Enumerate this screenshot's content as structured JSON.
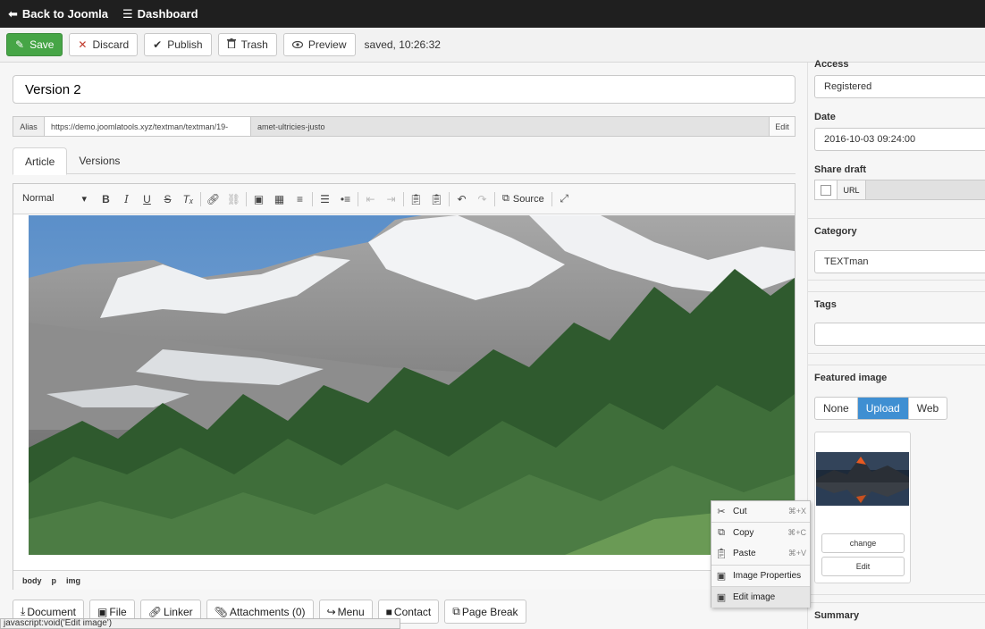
{
  "topbar": {
    "back_label": "Back to Joomla",
    "dashboard_label": "Dashboard"
  },
  "toolbar": {
    "save_label": "Save",
    "discard_label": "Discard",
    "publish_label": "Publish",
    "trash_label": "Trash",
    "preview_label": "Preview",
    "saved_status": "saved, 10:26:32"
  },
  "article": {
    "title_value": "Version 2",
    "alias_label": "Alias",
    "alias_url": "https://demo.joomlatools.xyz/textman/textman/19-",
    "alias_slug": "amet-ultricies-justo",
    "alias_edit_label": "Edit",
    "tabs": [
      {
        "label": "Article"
      },
      {
        "label": "Versions"
      }
    ]
  },
  "editor": {
    "format_value": "Normal",
    "source_label": "Source",
    "path": [
      "body",
      "p",
      "img"
    ]
  },
  "bottom_buttons": [
    {
      "label": "Document"
    },
    {
      "label": "File"
    },
    {
      "label": "Linker"
    },
    {
      "label": "Attachments (0)"
    },
    {
      "label": "Menu"
    },
    {
      "label": "Contact"
    },
    {
      "label": "Page Break"
    }
  ],
  "status_url": "javascript:void('Edit image')",
  "sidebar": {
    "access_label": "Access",
    "access_value": "Registered",
    "date_label": "Date",
    "date_value": "2016-10-03 09:24:00",
    "share_label": "Share draft",
    "share_url_label": "URL",
    "category_label": "Category",
    "category_value": "TEXTman",
    "tags_label": "Tags",
    "featured_label": "Featured image",
    "featured_options": [
      {
        "label": "None"
      },
      {
        "label": "Upload"
      },
      {
        "label": "Web"
      }
    ],
    "featured_selected": "Upload",
    "change_label": "change",
    "edit_label": "Edit",
    "summary_label": "Summary"
  },
  "context_menu": {
    "items": [
      {
        "label": "Cut",
        "shortcut": "⌘+X"
      },
      {
        "label": "Copy",
        "shortcut": "⌘+C"
      },
      {
        "label": "Paste",
        "shortcut": "⌘+V"
      },
      {
        "label": "Image Properties",
        "shortcut": ""
      },
      {
        "label": "Edit image",
        "shortcut": ""
      }
    ]
  },
  "colors": {
    "topbar_bg": "#1f1f1f",
    "save_green": "#46a546",
    "upload_blue": "#3f8fd2"
  }
}
